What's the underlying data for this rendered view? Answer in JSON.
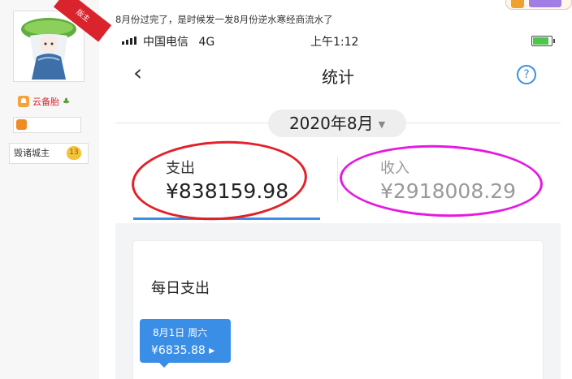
{
  "sidebar": {
    "ribbon": "版主",
    "rank_label": "云备胎",
    "title": "毁诸城主",
    "level": "13"
  },
  "post": {
    "text": "8月份过完了，是时候发一发8月份逆水寒经商流水了"
  },
  "phone": {
    "carrier": "中国电信",
    "network": "4G",
    "time": "上午1:12",
    "battery_level": 0.85,
    "nav": {
      "back_icon": "‹",
      "title": "统计",
      "help_icon": "?"
    },
    "month": "2020年8月",
    "tabs": {
      "expense_label": "支出",
      "expense_amount": "¥838159.98",
      "income_label": "收入",
      "income_amount": "¥2918008.29"
    },
    "card": {
      "title": "每日支出",
      "tooltip_date": "8月1日 周六",
      "tooltip_amount": "¥6835.88 ▸"
    }
  },
  "colors": {
    "accent": "#3a8ee6",
    "annotation_red": "#e3202a",
    "annotation_magenta": "#e619e0"
  }
}
